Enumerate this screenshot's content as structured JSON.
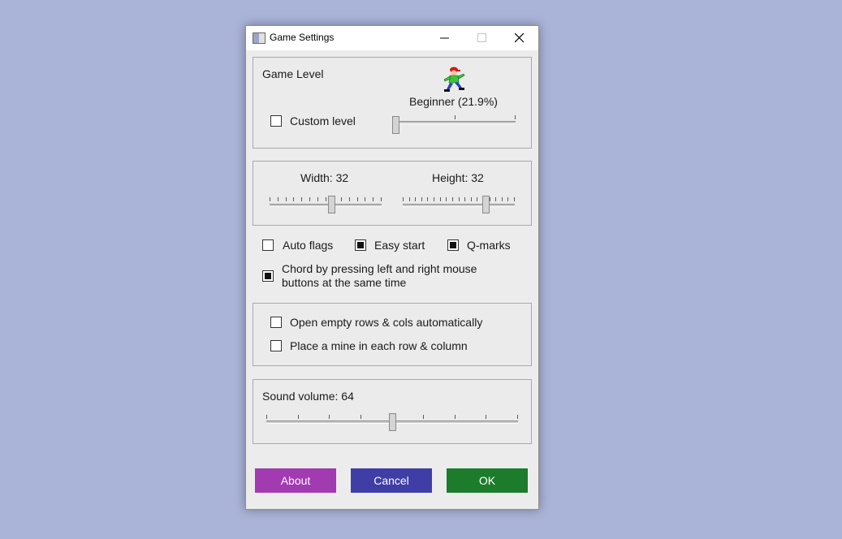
{
  "window": {
    "title": "Game Settings"
  },
  "level": {
    "heading": "Game Level",
    "level_text": "Beginner (21.9%)",
    "custom_label": "Custom level",
    "custom_checked": false,
    "slider_value_fraction": 0.0,
    "icon": "player-icon"
  },
  "size": {
    "width_label": "Width: 32",
    "height_label": "Height: 32",
    "width_fraction": 0.55,
    "height_fraction": 0.75
  },
  "options": {
    "auto_flags": {
      "label": "Auto flags",
      "checked": false
    },
    "easy_start": {
      "label": "Easy start",
      "checked": true
    },
    "q_marks": {
      "label": "Q-marks",
      "checked": true
    },
    "chord": {
      "label_line1": "Chord by pressing left and right mouse",
      "label_line2": "buttons at the same time",
      "checked": true
    }
  },
  "extras": {
    "open_empty": {
      "label": "Open empty rows & cols automatically",
      "checked": false
    },
    "place_mine": {
      "label": "Place a mine in each row & column",
      "checked": false
    }
  },
  "sound": {
    "label": "Sound volume: 64",
    "value_fraction": 0.5
  },
  "buttons": {
    "about": {
      "label": "About",
      "color": "#a23ab1"
    },
    "cancel": {
      "label": "Cancel",
      "color": "#3f3ea6"
    },
    "ok": {
      "label": "OK",
      "color": "#1c7c2c"
    }
  },
  "colors": {
    "tile": "#aab4d8",
    "dialog_bg": "#ececec"
  }
}
